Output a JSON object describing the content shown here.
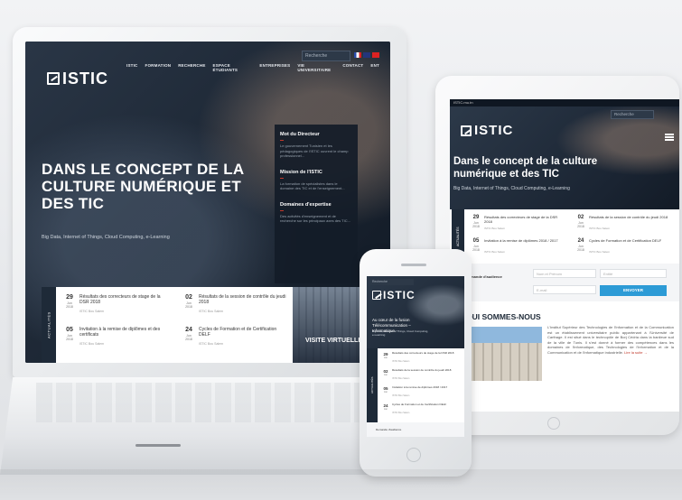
{
  "laptop": {
    "search_placeholder": "Recherche",
    "nav": [
      "ISTIC",
      "FORMATION",
      "RECHERCHE",
      "ESPACE ÉTUDIANTS",
      "ENTREPRISES",
      "VIE UNIVERSITAIRE",
      "CONTACT",
      "ENT"
    ],
    "logo": "ISTIC",
    "hero_title": "DANS LE CONCEPT DE LA CULTURE NUMÉRIQUE ET DES TIC",
    "hero_subtitle": "Big Data, Internet of Things, Cloud Computing, e-Learning",
    "side_panel": [
      {
        "heading": "Mot du Directeur",
        "text": "Le gouvernement Tunisien et les pédagogiques de l'ISTIC ouvrent le champ professionnel..."
      },
      {
        "heading": "Mission de l'ISTIC",
        "text": "La formation de spécialistes dans le domaine des TIC et de l'enseignement..."
      },
      {
        "heading": "Domaines d'expertise",
        "text": "Des activités d'enseignement et de recherche sur les principaux axes des TIC..."
      }
    ],
    "news_label": "ACTUALITÉS",
    "news": [
      {
        "day": "29",
        "month": "Jun 2018",
        "title": "Résultats des correcteurs de stage de la DSR 2018",
        "meta": "ISTIC Bou Salem"
      },
      {
        "day": "02",
        "month": "Jun 2018",
        "title": "Résultats de la session de contrôle du jeudi 2018",
        "meta": "ISTIC Bou Salem"
      },
      {
        "day": "05",
        "month": "Jun 2018",
        "title": "Invitation à la remise de diplômes et des certificats",
        "meta": "ISTIC Bou Salem"
      },
      {
        "day": "24",
        "month": "Jun 2018",
        "title": "Cycles de Formation et de Certification DELF",
        "meta": "ISTIC Bou Salem"
      }
    ],
    "visit_label": "VISITE VIRTUELLE"
  },
  "tablet": {
    "status": "ISTIC.rnu.tn",
    "search_placeholder": "Recherche",
    "logo": "ISTIC",
    "hero_title": "Dans le concept de la culture numérique et des TIC",
    "hero_subtitle": "Big Data, Internet of Things, Cloud Computing, e-Learning",
    "news_label": "ACTUALITÉS",
    "news": [
      {
        "day": "29",
        "month": "Jun 2018",
        "title": "Résultats des correcteurs de stage de la DSR 2018",
        "meta": "ISTIC Bou Salem"
      },
      {
        "day": "02",
        "month": "Jun 2018",
        "title": "Résultats de la session de contrôle du jeudi 2018",
        "meta": "ISTIC Bou Salem"
      },
      {
        "day": "05",
        "month": "Jun 2018",
        "title": "Invitation à la remise de diplômes 2018 / 2017",
        "meta": "ISTIC Bou Salem"
      },
      {
        "day": "24",
        "month": "Jun 2018",
        "title": "Cycles de Formation et de Certification DELF",
        "meta": "ISTIC Bou Salem"
      }
    ],
    "form_label": "Demande d'audience",
    "form_fields": [
      "Nom et Prénom",
      "Entité",
      "E-mail",
      "Téléphone"
    ],
    "form_button": "ENVOYER",
    "about_title": "QUI SOMMES-NOUS",
    "about_text": "L'Institut Supérieur des Technologies de l'Information et de la Communication est un établissement universitaire public appartenant à l'Université de Carthage. Il est situé dans le technopôle de Borj Cédria dans la banlieue sud de la ville de Tunis. Il s'est donné à former des compétences dans les domaines de l'informatique, des Technologies de l'Information et de la Communication et de l'informatique industrielle.",
    "about_link": "Lire la suite →"
  },
  "phone": {
    "search_placeholder": "Recherche",
    "logo": "ISTIC",
    "hero_title": "Au cœur de la fusion Télécommunication – Informatique.",
    "hero_subtitle": "Big Data, Internet of Things, Cloud Computing, e-Learning",
    "news_label": "ACTUALITÉS",
    "news": [
      {
        "day": "29",
        "month": "Jun",
        "title": "Résultats des correcteurs de stage de la DSR 2018",
        "meta": "ISTIC Bou Salem"
      },
      {
        "day": "02",
        "month": "Jun",
        "title": "Résultats de la session de contrôle du jeudi 2018",
        "meta": "ISTIC Bou Salem"
      },
      {
        "day": "05",
        "month": "Jun",
        "title": "Invitation à la remise de diplômes 2018 / 2017",
        "meta": "ISTIC Bou Salem"
      },
      {
        "day": "24",
        "month": "Jun",
        "title": "Cycles de Formation et de Certification DELF",
        "meta": "ISTIC Bou Salem"
      }
    ],
    "bottom_label": "Demande d'audience"
  },
  "colors": {
    "accent": "#c0392b",
    "button": "#2d9bd6",
    "dark": "#1e2a38"
  }
}
